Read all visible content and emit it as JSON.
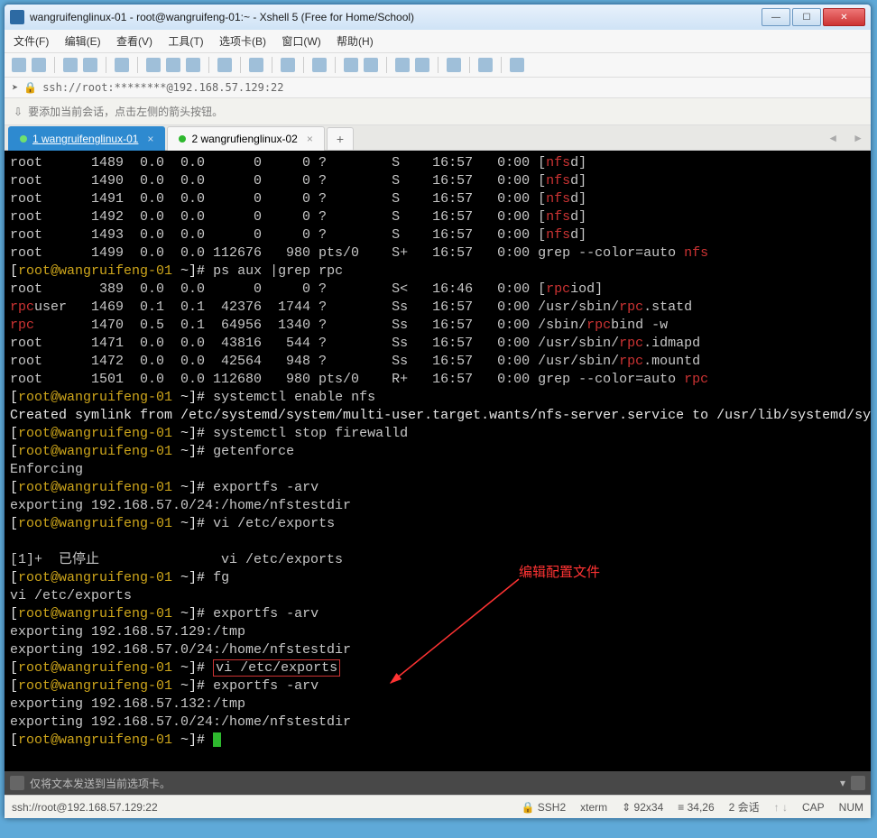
{
  "title": "wangruifenglinux-01 - root@wangruifeng-01:~ - Xshell 5 (Free for Home/School)",
  "menu": {
    "file": "文件(F)",
    "edit": "编辑(E)",
    "view": "查看(V)",
    "tools": "工具(T)",
    "tabs": "选项卡(B)",
    "window": "窗口(W)",
    "help": "帮助(H)"
  },
  "address": "ssh://root:********@192.168.57.129:22",
  "hint": "要添加当前会话，点击左侧的箭头按钮。",
  "tabs": [
    {
      "label": "1 wangruifenglinux-01",
      "active": true
    },
    {
      "label": "2 wangrufienglinux-02",
      "active": false
    }
  ],
  "prompt": {
    "user": "root",
    "host": "wangruifeng-01",
    "cwd": "~",
    "sym": "#"
  },
  "ps_rows": [
    {
      "u": "root",
      "pid": "1489",
      "cpu": "0.0",
      "mem": "0.0",
      "vsz": "0",
      "rss": "0",
      "tty": "?",
      "stat": "S",
      "start": "16:57",
      "time": "0:00",
      "cmd": "[",
      "hl": "nfs",
      "tail": "d]"
    },
    {
      "u": "root",
      "pid": "1490",
      "cpu": "0.0",
      "mem": "0.0",
      "vsz": "0",
      "rss": "0",
      "tty": "?",
      "stat": "S",
      "start": "16:57",
      "time": "0:00",
      "cmd": "[",
      "hl": "nfs",
      "tail": "d]"
    },
    {
      "u": "root",
      "pid": "1491",
      "cpu": "0.0",
      "mem": "0.0",
      "vsz": "0",
      "rss": "0",
      "tty": "?",
      "stat": "S",
      "start": "16:57",
      "time": "0:00",
      "cmd": "[",
      "hl": "nfs",
      "tail": "d]"
    },
    {
      "u": "root",
      "pid": "1492",
      "cpu": "0.0",
      "mem": "0.0",
      "vsz": "0",
      "rss": "0",
      "tty": "?",
      "stat": "S",
      "start": "16:57",
      "time": "0:00",
      "cmd": "[",
      "hl": "nfs",
      "tail": "d]"
    },
    {
      "u": "root",
      "pid": "1493",
      "cpu": "0.0",
      "mem": "0.0",
      "vsz": "0",
      "rss": "0",
      "tty": "?",
      "stat": "S",
      "start": "16:57",
      "time": "0:00",
      "cmd": "[",
      "hl": "nfs",
      "tail": "d]"
    },
    {
      "u": "root",
      "pid": "1499",
      "cpu": "0.0",
      "mem": "0.0",
      "vsz": "112676",
      "rss": "980",
      "tty": "pts/0",
      "stat": "S+",
      "start": "16:57",
      "time": "0:00",
      "cmd": "grep --color=auto ",
      "hl": "nfs",
      "tail": ""
    }
  ],
  "cmd_psrpc": "ps aux |grep rpc",
  "rpc_rows": [
    {
      "u": "root",
      "pid": "389",
      "cpu": "0.0",
      "mem": "0.0",
      "vsz": "0",
      "rss": "0",
      "tty": "?",
      "stat": "S<",
      "start": "16:46",
      "time": "0:00",
      "cmd": "[",
      "hl": "rpc",
      "tail": "iod]"
    },
    {
      "u": "rpcuser",
      "uhl": "rpc",
      "utail": "user",
      "pid": "1469",
      "cpu": "0.1",
      "mem": "0.1",
      "vsz": "42376",
      "rss": "1744",
      "tty": "?",
      "stat": "Ss",
      "start": "16:57",
      "time": "0:00",
      "cmd": "/usr/sbin/",
      "hl": "rpc",
      "tail": ".statd"
    },
    {
      "u": "rpc",
      "uhl": "rpc",
      "utail": "",
      "pid": "1470",
      "cpu": "0.5",
      "mem": "0.1",
      "vsz": "64956",
      "rss": "1340",
      "tty": "?",
      "stat": "Ss",
      "start": "16:57",
      "time": "0:00",
      "cmd": "/sbin/",
      "hl": "rpc",
      "tail": "bind -w"
    },
    {
      "u": "root",
      "pid": "1471",
      "cpu": "0.0",
      "mem": "0.0",
      "vsz": "43816",
      "rss": "544",
      "tty": "?",
      "stat": "Ss",
      "start": "16:57",
      "time": "0:00",
      "cmd": "/usr/sbin/",
      "hl": "rpc",
      "tail": ".idmapd"
    },
    {
      "u": "root",
      "pid": "1472",
      "cpu": "0.0",
      "mem": "0.0",
      "vsz": "42564",
      "rss": "948",
      "tty": "?",
      "stat": "Ss",
      "start": "16:57",
      "time": "0:00",
      "cmd": "/usr/sbin/",
      "hl": "rpc",
      "tail": ".mountd"
    },
    {
      "u": "root",
      "pid": "1501",
      "cpu": "0.0",
      "mem": "0.0",
      "vsz": "112680",
      "rss": "980",
      "tty": "pts/0",
      "stat": "R+",
      "start": "16:57",
      "time": "0:00",
      "cmd": "grep --color=auto ",
      "hl": "rpc",
      "tail": ""
    }
  ],
  "lines": {
    "enable": "systemctl enable nfs",
    "symlink": "Created symlink from /etc/systemd/system/multi-user.target.wants/nfs-server.service to /usr/lib/systemd/system/nfs-server.service.",
    "stopfw": "systemctl stop firewalld",
    "getenf": "getenforce",
    "enforcing": "Enforcing",
    "exportfs": "exportfs -arv",
    "exp1": "exporting 192.168.57.0/24:/home/nfstestdir",
    "vi": "vi /etc/exports",
    "stopped": "[1]+  已停止               vi /etc/exports",
    "fg": "fg",
    "viline": "vi /etc/exports",
    "exp129": "exporting 192.168.57.129:/tmp",
    "exp132": "exporting 192.168.57.132:/tmp",
    "vi_boxed": "vi /etc/exports",
    "anno": "编辑配置文件"
  },
  "cmdbar_label": "仅将文本发送到当前选项卡。",
  "status": {
    "conn": "ssh://root@192.168.57.129:22",
    "proto": "SSH2",
    "term": "xterm",
    "size": "92x34",
    "pos": "34,26",
    "sess": "2 会话",
    "cap": "CAP",
    "num": "NUM"
  }
}
